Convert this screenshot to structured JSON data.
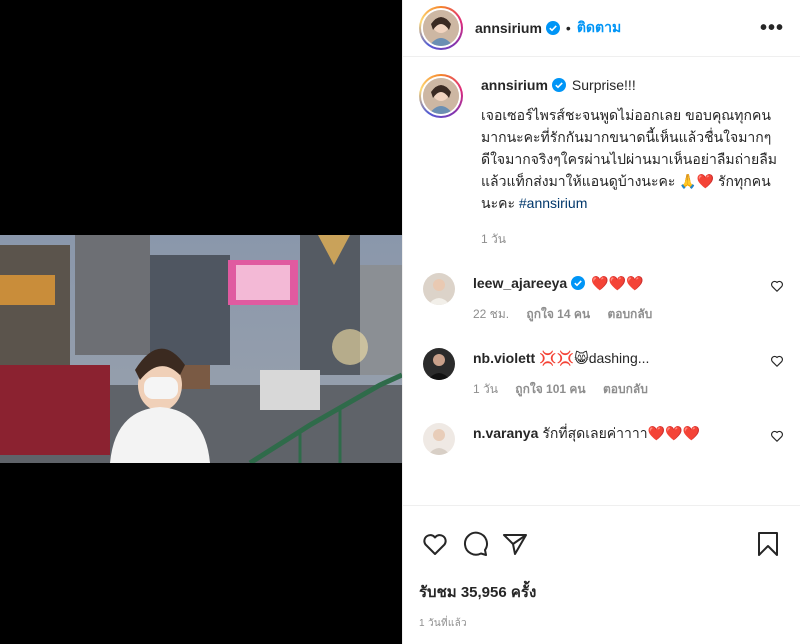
{
  "post": {
    "username": "annsirium",
    "follow_label": "ติดตาม",
    "separator": "•",
    "more_label": "•••",
    "caption_title": "Surprise!!!",
    "caption_body": "เจอเซอร์ไพรส์ชะจนพูดไม่ออกเลย ขอบคุณทุกคนมากนะคะที่รักกันมากขนาดนี้เห็นแล้วชื่นใจมากๆดีใจมากจริงๆใครผ่านไปผ่านมาเห็นอย่าลืมถ่ายลืมแล้วแท็กส่งมาให้แอนดูบ้างนะคะ 🙏❤️ รักทุกคนนะคะ",
    "hashtag": "#annsirium",
    "caption_time": "1 วัน"
  },
  "comments": [
    {
      "username": "leew_ajareeya",
      "verified": true,
      "text": "❤️❤️❤️",
      "time": "22 ชม.",
      "likes": "ถูกใจ 14 คน",
      "reply": "ตอบกลับ"
    },
    {
      "username": "nb.violett",
      "verified": false,
      "text": "💢💢😸dashing...",
      "time": "1 วัน",
      "likes": "ถูกใจ 101 คน",
      "reply": "ตอบกลับ"
    },
    {
      "username": "n.varanya",
      "verified": false,
      "text": "รักที่สุดเลยค่าาาา❤️❤️❤️",
      "time": "",
      "likes": "",
      "reply": ""
    }
  ],
  "footer": {
    "views": "รับชม 35,956 ครั้ง",
    "posted": "1 วันที่แล้ว"
  },
  "icons": {
    "like": "heart-icon",
    "comment": "comment-icon",
    "share": "share-icon",
    "save": "bookmark-icon",
    "verified": "verified-badge-icon"
  },
  "colors": {
    "link_blue": "#0095f6",
    "hashtag": "#00376b",
    "meta_gray": "#8e8e8e",
    "text": "#262626",
    "verified": "#0095f6"
  }
}
